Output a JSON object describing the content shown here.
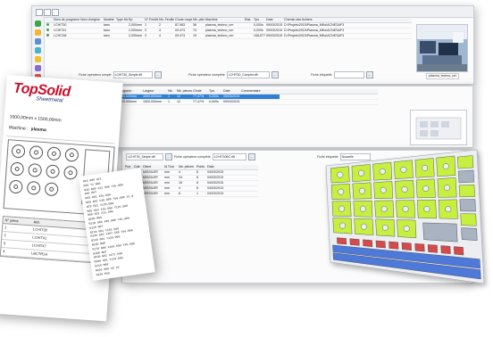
{
  "colors": {
    "accent": "#2f7fd6",
    "logo_red": "#c8102e",
    "logo_blue": "#1f3b7a",
    "nest_green": "#c7ef3f",
    "nest_blue": "#4f79d9",
    "nest_red": "#d64a4a",
    "nest_grey": "#a9b3c2"
  },
  "win1": {
    "grid_headers": [
      "",
      "Nom de programme",
      "Nom d'origine",
      "Modèle",
      "Type Mat.",
      "Ep.",
      "N° Feuille",
      "Nb. Feuilles",
      "Chute moyen",
      "Nb. pièces",
      "Machine",
      "Etat",
      "Tps",
      "Date",
      "Chemin des fichiers"
    ],
    "rows": [
      [
        "",
        "LCHIT30",
        "",
        "tano",
        "",
        "2,000mm",
        "1",
        "2",
        "87.083",
        "36",
        "plasma_techno_nm",
        "",
        "0,000s",
        "09/03/2015",
        "D:\\Projets\\2015\\Plasma_Mil\\s\\ACNESAF3"
      ],
      [
        "",
        "LCHIT41",
        "",
        "tano",
        "",
        "2,000mm",
        "2",
        "3",
        "09.473",
        "74",
        "plasma_techno_nm",
        "",
        "0,000s",
        "09/03/2015",
        "D:\\Projets\\2015\\Plasma_Mil\\s\\ACNESAF3"
      ],
      [
        "",
        "LCHIT48",
        "",
        "tano",
        "",
        "2,000mm",
        "3",
        "4",
        "09.473",
        "19",
        "plasma_techno_nm",
        "",
        "108,677s",
        "09/03/2015",
        "D:\\Projets\\2015\\Plasma_Mil\\s\\ACNESAF3"
      ]
    ],
    "field1_label": "Fiche opérateur simple",
    "field1_value": "LCHIT30_Simple.dft",
    "field2_label": "Fiche opérateur complète",
    "field2_value": "LCHIT30_Complet.dft",
    "field3_label": "Fiche étiquette",
    "field3_value": "",
    "photo_caption": "plasma_techno_nm"
  },
  "win2": {
    "grid_headers": [
      "",
      "Longueur",
      "Largeur",
      "Nb.",
      "Nb. pièces",
      "Chute",
      "Tps",
      "Date",
      "Commentaire"
    ],
    "rows": [
      [
        "",
        "1000,000mm",
        "1500,000mm",
        "1",
        "12",
        "77,47%",
        "0,000s",
        "09/03/2015",
        ""
      ],
      [
        "",
        "1000,000mm",
        "1500,000mm",
        "1",
        "12",
        "77,47%",
        "0,000s",
        "09/03/2015",
        ""
      ]
    ],
    "selected_row": 0
  },
  "win3": {
    "field1_value": "LCHIT30_Simple.dft",
    "field2_label": "Fiche opérateur complète",
    "field2_value": "LCHIT30BC.dft",
    "field3_label": "Fiche étiquette",
    "field3_value": "Nouvelle",
    "grid_headers": [
      "Pce",
      "Cde",
      "Client",
      "Id Trou",
      "Nb. pièces",
      "Poids",
      "Date"
    ],
    "rows": [
      [
        "",
        "",
        "MISSILER",
        "mm",
        "4",
        "8",
        "04/03/2015"
      ],
      [
        "",
        "",
        "MISSILER",
        "mm",
        "24",
        "8",
        "04/03/2015"
      ],
      [
        "",
        "",
        "MISSILER",
        "mm",
        "16",
        "8",
        "04/03/2015"
      ],
      [
        "",
        "",
        "MISSILER",
        "mm",
        "4",
        "8",
        "04/03/2015"
      ],
      [
        "",
        "",
        "MISSILER",
        "mm",
        "6",
        "1",
        "04/03/2015"
      ]
    ]
  },
  "report": {
    "logo_text": "TopSolid",
    "logo_sub": "Sheetmetal",
    "sheet_size": "1000,00mm x 1500,00mm",
    "machine_label": "Machine :",
    "machine_value": "plasma",
    "table_headers": [
      "N° pièce",
      "Réf."
    ],
    "rows": [
      [
        "1",
        "LCHIT30"
      ],
      [
        "2",
        "LCHIT41"
      ],
      [
        "3",
        "LCHIT47"
      ],
      [
        "4",
        "LBCTR1A"
      ]
    ]
  },
  "gcode": {
    "lines": [
      "N10 G90 G71",
      "N20 T1 M06",
      "N30 G00 X12.500 Y45.000",
      "N40 M07",
      "N50 G01 X35.000",
      "N60 G02 X40.000 Y50.000 I5.0",
      "N70 G01 Y120.000",
      "N80 G03 X35.000 Y125.000",
      "N90 G01 X12.500",
      "N100 M08",
      "N110 G00 X80.000 Y45.000",
      "N120 M07",
      "N130 G01 X102.500",
      "N140 G02 X107.500 Y50.000",
      "N150 G01 Y120.000",
      "N160 M08",
      "N170 G00 X150.000 Y45.000",
      "N180 M07",
      "N190 G01 X172.500",
      "N200 G01 Y120.000",
      "N210 M08",
      "N220 G00 X0 Y0",
      "N230 M30"
    ]
  }
}
